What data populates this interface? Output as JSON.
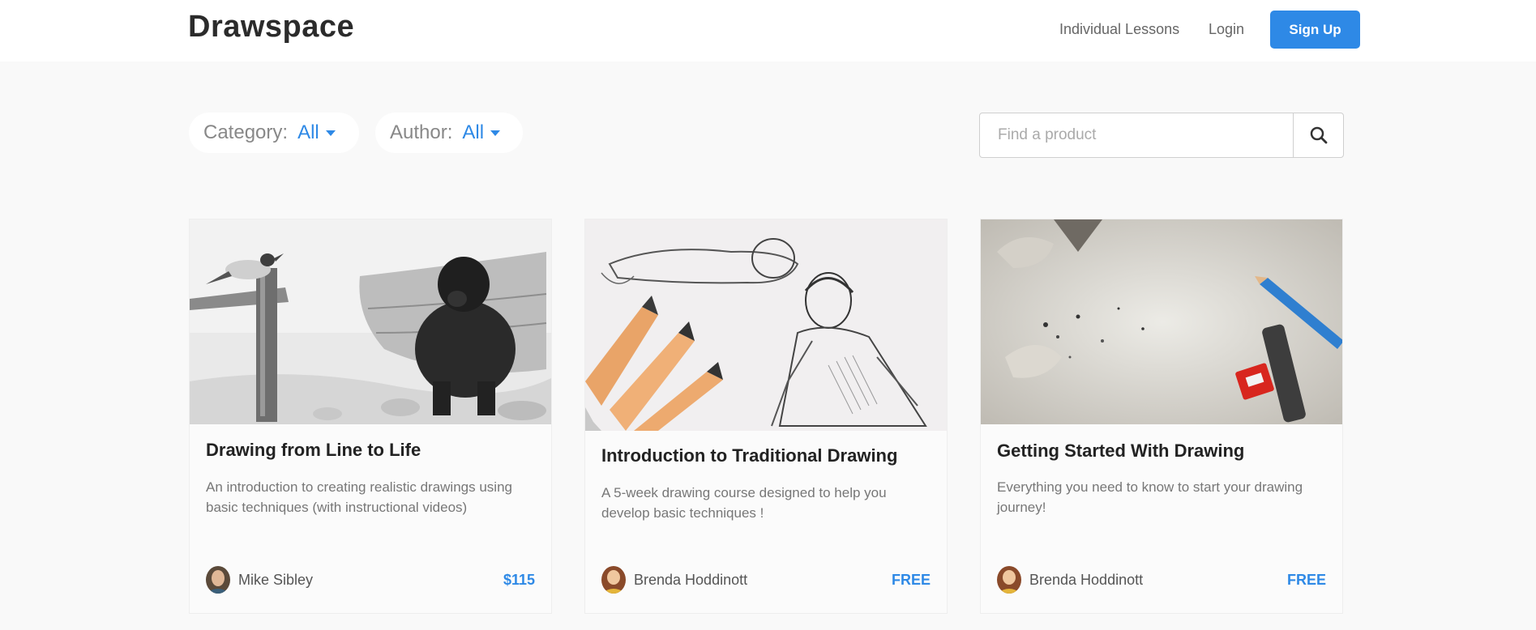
{
  "brand": {
    "logo_text": "Drawspace",
    "accent_color": "#2e89e6"
  },
  "nav": {
    "individual_lessons": "Individual Lessons",
    "login": "Login",
    "signup": "Sign Up"
  },
  "filters": {
    "category_label": "Category:",
    "category_value": "All",
    "author_label": "Author:",
    "author_value": "All"
  },
  "search": {
    "placeholder": "Find a product",
    "icon": "search-icon"
  },
  "products": [
    {
      "title": "Drawing from Line to Life",
      "description": "An introduction to creating realistic drawings using basic techniques (with instructional videos)",
      "author": "Mike Sibley",
      "price": "$115"
    },
    {
      "title": "Introduction to Traditional Drawing",
      "description": "A 5-week drawing course designed to help you develop basic techniques !",
      "author": "Brenda Hoddinott",
      "price": "FREE"
    },
    {
      "title": "Getting Started With Drawing",
      "description": "Everything you need to know to start your drawing journey!",
      "author": "Brenda Hoddinott",
      "price": "FREE"
    }
  ]
}
